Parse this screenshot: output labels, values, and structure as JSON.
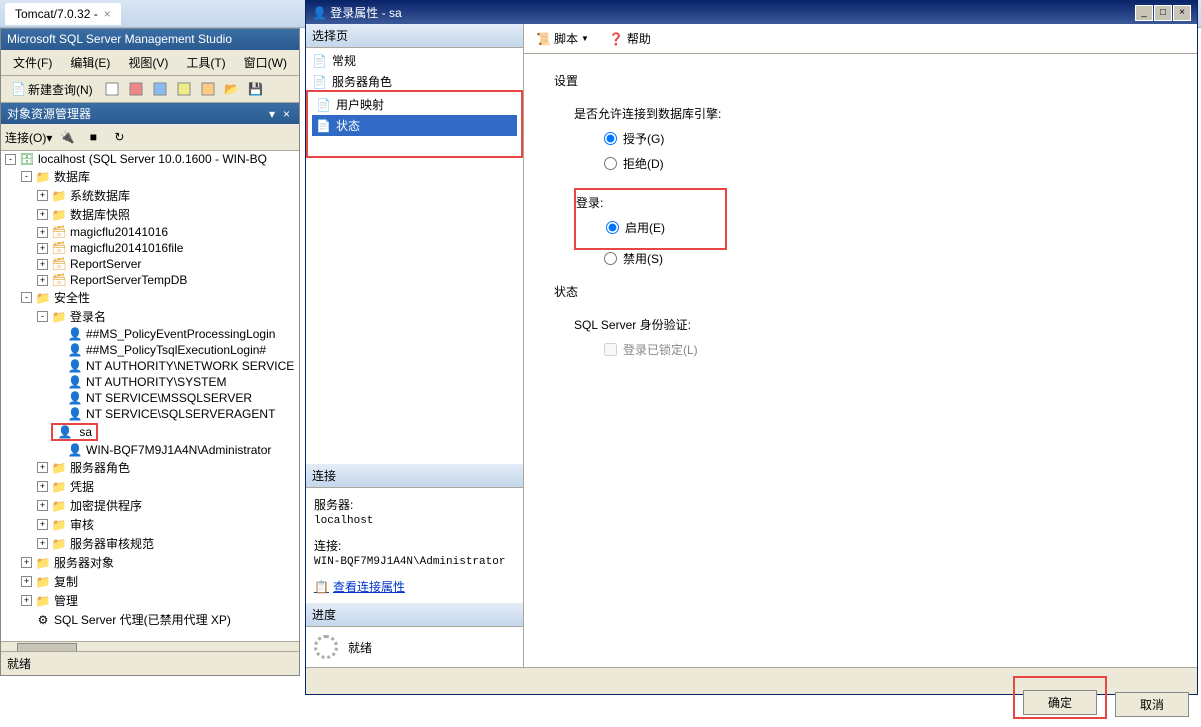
{
  "browser": {
    "tab_title": "Tomcat/7.0.32 -"
  },
  "ssms": {
    "title": "Microsoft SQL Server Management Studio",
    "menu": {
      "file": "文件(F)",
      "edit": "编辑(E)",
      "view": "视图(V)",
      "tools": "工具(T)",
      "window": "窗口(W)"
    },
    "toolbar": {
      "new_query": "新建查询(N)"
    },
    "object_explorer": {
      "title": "对象资源管理器",
      "connect": "连接(O)▾"
    },
    "tree": {
      "server": "localhost (SQL Server 10.0.1600 - WIN-BQ",
      "databases": "数据库",
      "sys_databases": "系统数据库",
      "db_snapshot": "数据库快照",
      "db1": "magicflu20141016",
      "db2": "magicflu20141016file",
      "db3": "ReportServer",
      "db4": "ReportServerTempDB",
      "security": "安全性",
      "logins": "登录名",
      "login1": "##MS_PolicyEventProcessingLogin",
      "login2": "##MS_PolicyTsqlExecutionLogin#",
      "login3": "NT AUTHORITY\\NETWORK SERVICE",
      "login4": "NT AUTHORITY\\SYSTEM",
      "login5": "NT SERVICE\\MSSQLSERVER",
      "login6": "NT SERVICE\\SQLSERVERAGENT",
      "login_sa": "sa",
      "login7": "WIN-BQF7M9J1A4N\\Administrator",
      "server_roles": "服务器角色",
      "credentials": "凭据",
      "crypto_providers": "加密提供程序",
      "audits": "审核",
      "server_audit_spec": "服务器审核规范",
      "server_objects": "服务器对象",
      "replication": "复制",
      "management": "管理",
      "sql_agent": "SQL Server 代理(已禁用代理 XP)"
    },
    "status": "就绪"
  },
  "dialog": {
    "title": "登录属性 - sa",
    "left": {
      "select_page": "选择页",
      "general": "常规",
      "server_roles": "服务器角色",
      "user_mapping": "用户映射",
      "status": "状态",
      "connection": "连接",
      "server_label": "服务器:",
      "server_value": "localhost",
      "conn_label": "连接:",
      "conn_value": "WIN-BQF7M9J1A4N\\Administrator",
      "view_props": "查看连接属性",
      "progress": "进度",
      "ready": "就绪"
    },
    "toolbar": {
      "script": "脚本",
      "help": "帮助"
    },
    "settings": {
      "header": "设置",
      "db_engine_label": "是否允许连接到数据库引擎:",
      "grant": "授予(G)",
      "deny": "拒绝(D)",
      "login_label": "登录:",
      "enabled": "启用(E)",
      "disabled": "禁用(S)",
      "status_label": "状态",
      "sql_auth_label": "SQL Server 身份验证:",
      "locked": "登录已锁定(L)"
    },
    "buttons": {
      "ok": "确定",
      "cancel": "取消"
    }
  }
}
